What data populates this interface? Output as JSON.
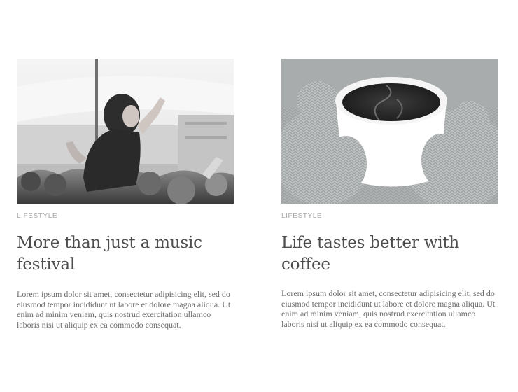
{
  "posts": [
    {
      "category": "LIFESTYLE",
      "title": "More than just a music festival",
      "excerpt": "Lorem ipsum dolor sit amet, consectetur adipisicing elit, sed do eiusmod tempor incididunt ut labore et dolore magna aliqua. Ut enim ad minim veniam, quis nostrud exercitation ullamco laboris nisi ut aliquip ex ea commodo consequat.",
      "image_icon": "concert-crowd-photo"
    },
    {
      "category": "LIFESTYLE",
      "title": "Life tastes better with coffee",
      "excerpt": "Lorem ipsum dolor sit amet, consectetur adipisicing elit, sed do eiusmod tempor incididunt ut labore et dolore magna aliqua. Ut enim ad minim veniam, quis nostrud exercitation ullamco laboris nisi ut aliquip ex ea commodo consequat.",
      "image_icon": "coffee-cup-photo"
    }
  ],
  "colors": {
    "category": "#a9a9a9",
    "title": "#4d4d4d",
    "text": "#6b6b6b"
  }
}
